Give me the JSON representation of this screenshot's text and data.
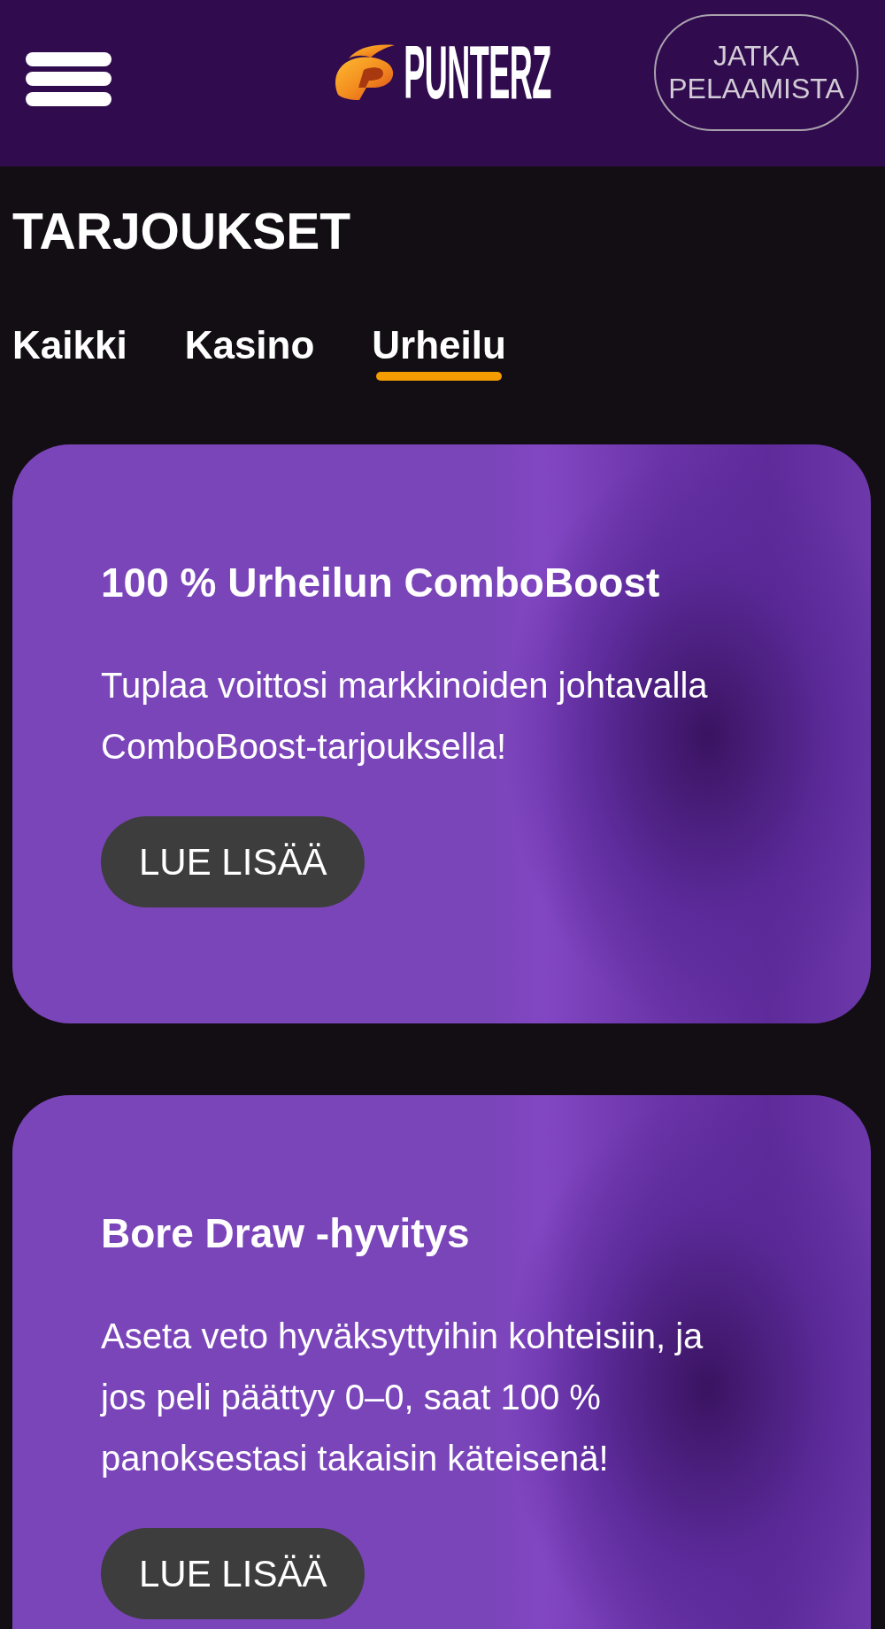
{
  "header": {
    "logo": {
      "text": "PUNTERZ"
    },
    "continue_button": {
      "label": "JATKA PELAAMISTA"
    }
  },
  "page_title": "TARJOUKSET",
  "tabs": [
    {
      "label": "Kaikki",
      "selected": false
    },
    {
      "label": "Kasino",
      "selected": false
    },
    {
      "label": "Urheilu",
      "selected": true
    }
  ],
  "promotions": [
    {
      "title": "100 % Urheilun ComboBoost",
      "description": "Tuplaa voittosi markkinoiden johtavalla ComboBoost-tarjouksella!",
      "button": "LUE LISÄÄ"
    },
    {
      "title": "Bore Draw -hyvitys",
      "description": "Aseta veto hyväksyttyihin kohteisiin, ja jos peli päättyy 0–0, saat 100 % panoksestasi takaisin käteisenä!",
      "button": "LUE LISÄÄ"
    }
  ]
}
